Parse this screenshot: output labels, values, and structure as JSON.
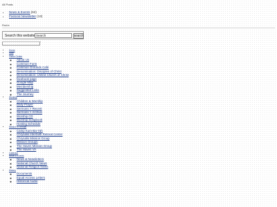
{
  "header": {
    "all_posts": "All Posts",
    "find_label": "Find in"
  },
  "categories": [
    {
      "label": "News & Events",
      "count": "(62)"
    },
    {
      "label": "Pastoral Newsletter",
      "count": "(13)"
    }
  ],
  "search": {
    "label": "Search this website",
    "value": "Search",
    "button": "search"
  },
  "nav": {
    "home": "Home",
    "staff": "Staff",
    "visitor_center": "Visitor Center",
    "visitor_items": [
      "About Us",
      "Common Form",
      "Common Grounds Café",
      "Denomination: Disciples of Christ",
      "Denomination: United Church of Christ",
      "facebook page",
      "Google Map",
      "Membership",
      "Suggested Links",
      "The Journey"
    ],
    "worship": "Worship",
    "worship_items": [
      "Children & Worship",
      "Daily Prayer",
      "Sermons > Recent",
      "Sermons > Archive",
      "Worship CD",
      "Worship Songbook",
      "Hosting Schedule"
    ],
    "mission": "Mission & Groups",
    "mission_items": [
      "Camp Kum-Ba-Yah",
      "Chrysalis Interfaith Retreat Center",
      "Chrysalis Mission Group",
      "Mission Groups",
      "The Haven Mission Group",
      "The Haven VA"
    ],
    "calendar": "Calendar",
    "news": "News & Events",
    "news_items": [
      "News & Newsletters",
      "National Church News",
      "National Religion News"
    ],
    "history": "History",
    "history_items": [
      "Documents",
      "Equal Access Letters",
      "Historical Audio"
    ]
  }
}
